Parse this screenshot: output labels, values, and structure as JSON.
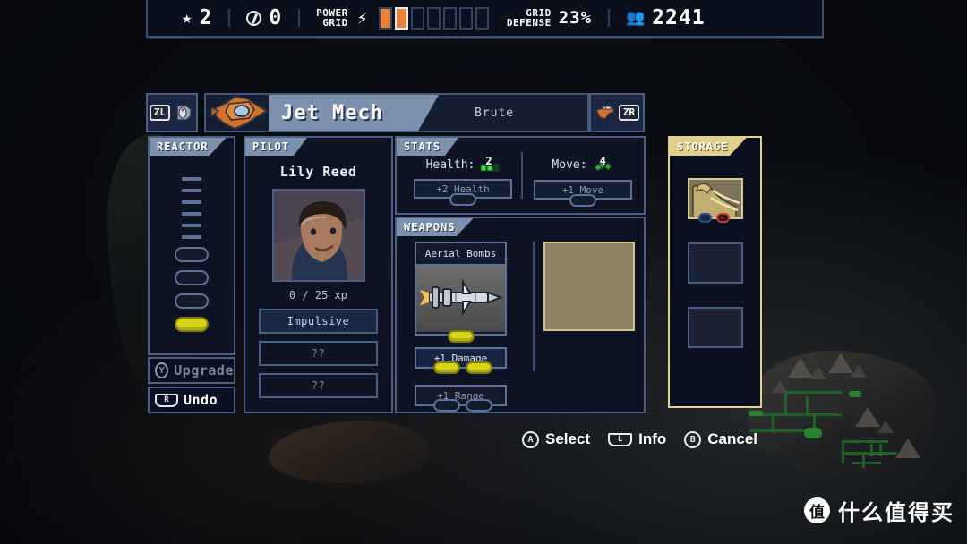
{
  "topbar": {
    "reputation_icon": "star-icon",
    "reputation": "2",
    "coins_icon": "coin-icon",
    "coins": "0",
    "power_grid_label_line1": "POWER",
    "power_grid_label_line2": "GRID",
    "power_grid_icon": "lightning-bolt-icon",
    "power_grid_total": 7,
    "power_grid_filled": 2,
    "power_grid_cursor_index": 1,
    "grid_defense_label_line1": "GRID",
    "grid_defense_label_line2": "DEFENSE",
    "grid_defense_value": "23%",
    "population_icon": "people-icon",
    "population": "2241"
  },
  "mech_header": {
    "prev_button_key": "ZL",
    "prev_button_icon": "shield-mech-icon",
    "next_button_key": "ZR",
    "next_button_icon": "flame-mech-icon",
    "portrait_icon": "jet-mech-icon",
    "name": "Jet Mech",
    "class": "Brute"
  },
  "reactor": {
    "title": "REACTOR",
    "dashes": 6,
    "slots": [
      {
        "filled": false
      },
      {
        "filled": false
      },
      {
        "filled": false
      },
      {
        "filled": true
      }
    ],
    "upgrade_button": {
      "key": "Y",
      "label": "Upgrade",
      "enabled": false
    },
    "undo_button": {
      "key": "R",
      "label": "Undo",
      "enabled": true
    }
  },
  "pilot": {
    "title": "PILOT",
    "name": "Lily Reed",
    "portrait_icon": "pilot-portrait",
    "xp": "0 / 25 xp",
    "skills": [
      {
        "label": "Impulsive",
        "locked": false
      },
      {
        "label": "??",
        "locked": true
      },
      {
        "label": "??",
        "locked": true
      }
    ]
  },
  "stats": {
    "title": "STATS",
    "health": {
      "label": "Health:",
      "value": "2",
      "icon": "health-bar-icon",
      "upgrade_label": "+2 Health",
      "pips": [
        {
          "filled": false
        }
      ]
    },
    "move": {
      "label": "Move:",
      "value": "4",
      "icon": "move-diamond-icon",
      "upgrade_label": "+1 Move",
      "pips": [
        {
          "filled": false
        }
      ]
    }
  },
  "weapons": {
    "title": "WEAPONS",
    "equipped": {
      "name": "Aerial Bombs",
      "art_icon": "missile-icon",
      "pips": [
        {
          "filled": true
        }
      ]
    },
    "upgrades": [
      {
        "label": "+1 Damage",
        "locked": false,
        "pips": [
          {
            "filled": true
          },
          {
            "filled": true
          }
        ]
      },
      {
        "label": "+1 Range",
        "locked": true,
        "pips": [
          {
            "filled": false
          },
          {
            "filled": false
          }
        ]
      }
    ],
    "preview_panel_color": "#8d8468"
  },
  "storage": {
    "title": "STORAGE",
    "accent_color": "#e3d08d",
    "slots": [
      {
        "filled": true,
        "icon": "fist-weapon-icon",
        "badges": [
          "blue-pip",
          "red-plus-pip"
        ]
      },
      {
        "filled": false
      },
      {
        "filled": false
      }
    ]
  },
  "prompts": [
    {
      "key": "A",
      "shape": "round",
      "label": "Select"
    },
    {
      "key": "L",
      "shape": "rect",
      "label": "Info"
    },
    {
      "key": "B",
      "shape": "round",
      "label": "Cancel"
    }
  ],
  "watermark": {
    "badge": "值",
    "text": "什么值得买"
  }
}
